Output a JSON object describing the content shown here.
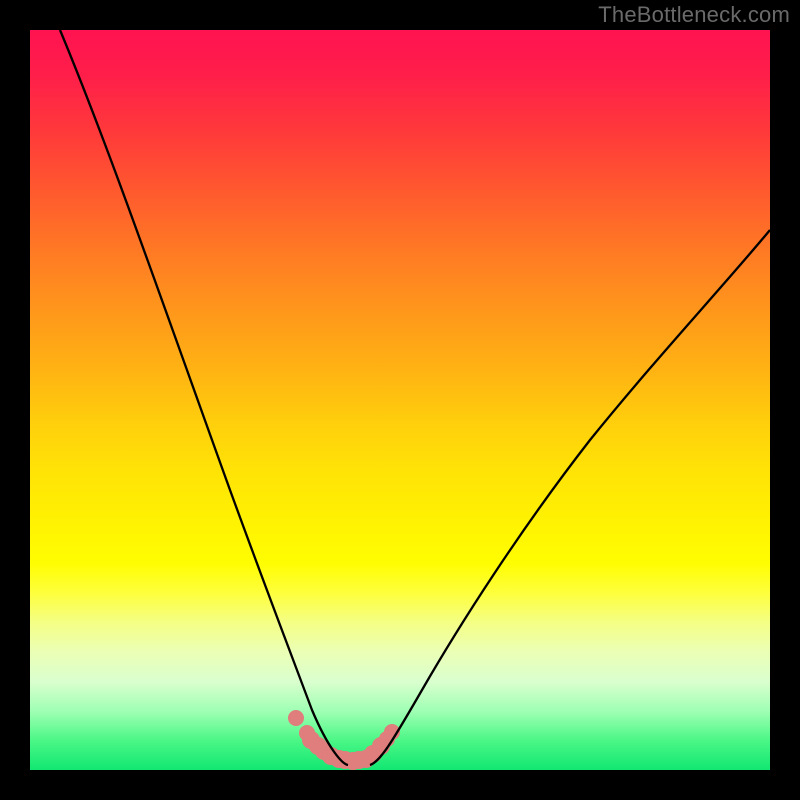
{
  "watermark": "TheBottleneck.com",
  "chart_data": {
    "type": "line",
    "title": "",
    "xlabel": "",
    "ylabel": "",
    "xlim": [
      0,
      100
    ],
    "ylim": [
      0,
      100
    ],
    "grid": false,
    "legend": false,
    "series": [
      {
        "name": "left-branch",
        "x": [
          4,
          10,
          16,
          22,
          27,
          31,
          34,
          36,
          38,
          39.5,
          41,
          43
        ],
        "y": [
          100,
          82,
          64,
          46,
          31,
          20,
          12.5,
          8.5,
          5.5,
          3.5,
          1.7,
          0.6
        ],
        "stroke": "#000000",
        "width": 2.2
      },
      {
        "name": "right-branch",
        "x": [
          46,
          48,
          50,
          53,
          57,
          62,
          68,
          75,
          82,
          90,
          100
        ],
        "y": [
          0.6,
          2.8,
          6,
          11,
          18,
          26,
          35,
          45,
          54,
          63,
          73
        ],
        "stroke": "#000000",
        "width": 2.2
      },
      {
        "name": "bottom-marker-band",
        "x": [
          36,
          37.5,
          38,
          39,
          39.7,
          40.7,
          41.8,
          42.6,
          43.6,
          44.4,
          45.4,
          46.3,
          47.5,
          48.2,
          49
        ],
        "y": [
          7,
          5,
          4,
          3.2,
          2.6,
          1.9,
          1.5,
          1.3,
          1.2,
          1.3,
          1.5,
          2.2,
          3.3,
          4.2,
          5.2
        ],
        "stroke": "#e07d7d",
        "width": 12,
        "dotted": true
      }
    ],
    "background_gradient": {
      "top": "#ff1351",
      "stops": [
        [
          "0%",
          "#ff1351"
        ],
        [
          "30%",
          "#ff7a24"
        ],
        [
          "60%",
          "#ffe406"
        ],
        [
          "80%",
          "#f4ff84"
        ],
        [
          "100%",
          "#11e772"
        ]
      ],
      "bottom": "#11e772"
    }
  }
}
